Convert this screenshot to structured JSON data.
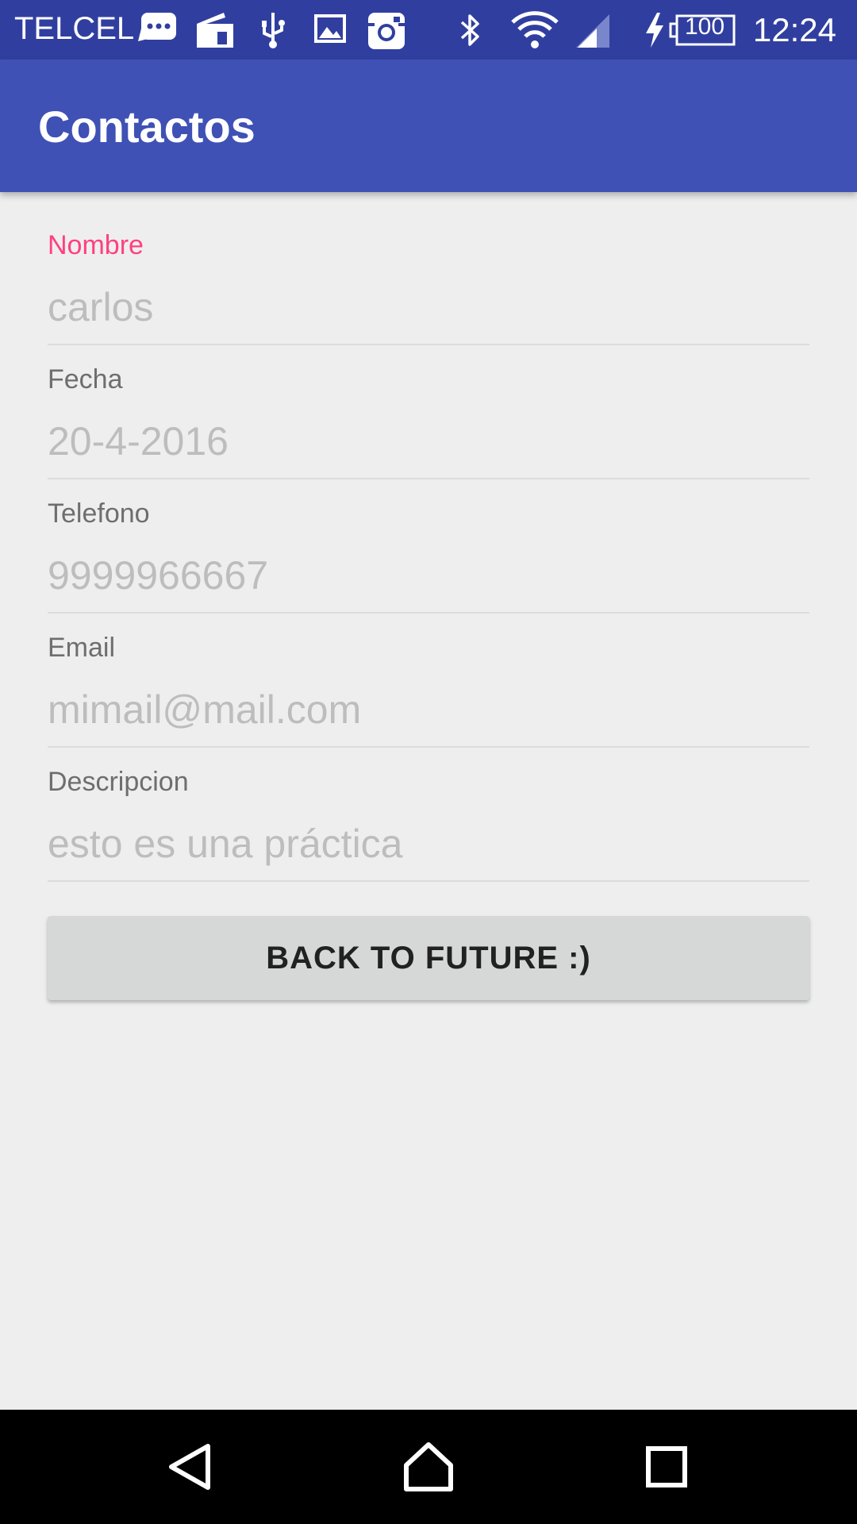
{
  "status_bar": {
    "carrier": "TELCEL",
    "battery_level": "100",
    "time": "12:24",
    "icons": [
      "message-icon",
      "sim-icon",
      "usb-icon",
      "image-icon",
      "instagram-icon",
      "bluetooth-icon",
      "wifi-icon",
      "signal-icon",
      "charging-icon",
      "battery-icon"
    ]
  },
  "app_bar": {
    "title": "Contactos",
    "background_color": "#3f51b5"
  },
  "form": {
    "fields": [
      {
        "label": "Nombre",
        "value": "carlos",
        "focused": true
      },
      {
        "label": "Fecha",
        "value": "20-4-2016"
      },
      {
        "label": "Telefono",
        "value": "9999966667"
      },
      {
        "label": "Email",
        "value": "mimail@mail.com"
      },
      {
        "label": "Descripcion",
        "value": "esto es una práctica"
      }
    ],
    "accent_color": "#ff4081"
  },
  "button": {
    "label": "BACK TO FUTURE :)"
  },
  "nav_bar": {
    "icons": [
      "back-icon",
      "home-icon",
      "recents-icon"
    ]
  }
}
